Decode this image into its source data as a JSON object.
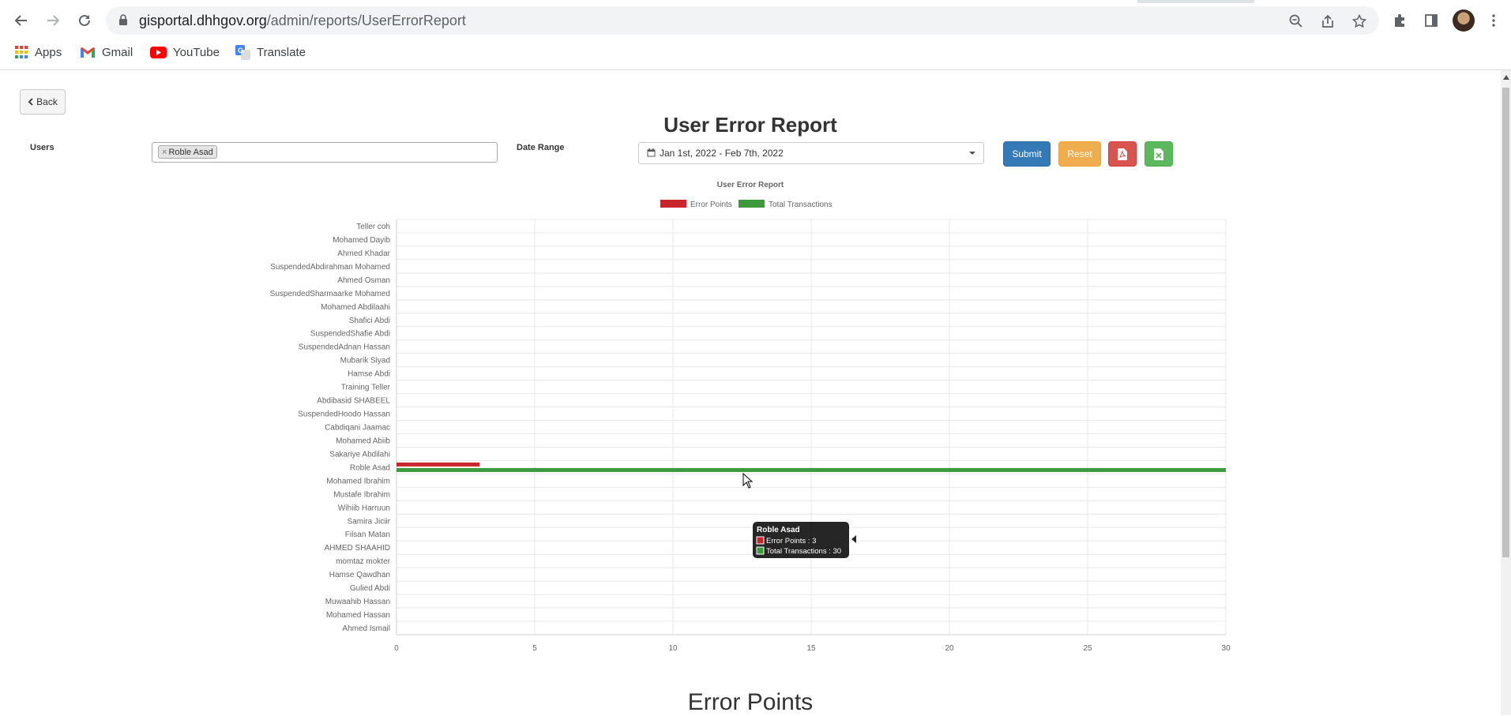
{
  "browser": {
    "url_domain": "gisportal.dhhgov.org",
    "url_path": "/admin/reports/UserErrorReport",
    "bookmarks": [
      {
        "label": "Apps",
        "icon": "apps-grid-icon"
      },
      {
        "label": "Gmail",
        "icon": "gmail-icon"
      },
      {
        "label": "YouTube",
        "icon": "youtube-icon"
      },
      {
        "label": "Translate",
        "icon": "translate-icon"
      }
    ]
  },
  "page": {
    "back_label": "Back",
    "title": "User Error Report",
    "users_label": "Users",
    "selected_user": "Roble Asad",
    "chip_remove": "×",
    "date_range_label": "Date Range",
    "date_range_value": "Jan 1st, 2022 - Feb 7th, 2022",
    "submit_label": "Submit",
    "reset_label": "Reset",
    "bottom_heading": "Error Points"
  },
  "colors": {
    "error": "#c9252c",
    "total": "#3c9a3c",
    "submit": "#337ab7",
    "reset": "#f0ad4e",
    "pdf": "#d9534f",
    "excel": "#5cb85c"
  },
  "tooltip": {
    "title": "Roble Asad",
    "line1": "Error Points : 3",
    "line2": "Total Transactions : 30"
  },
  "chart_data": {
    "type": "bar",
    "orientation": "horizontal",
    "title": "User Error Report",
    "legend_position": "top",
    "grid": true,
    "xlim": [
      0,
      30
    ],
    "x_ticks": [
      0,
      5,
      10,
      15,
      20,
      25,
      30
    ],
    "categories": [
      "Teller coh",
      "Mohamed Dayib",
      "Ahmed Khadar",
      "SuspendedAbdirahman Mohamed",
      "Ahmed Osman",
      "SuspendedSharmaarke Mohamed",
      "Mohamed Abdilaahi",
      "Shafici Abdi",
      "SuspendedShafie Abdi",
      "SuspendedAdnan Hassan",
      "Mubarik Siyad",
      "Hamse Abdi",
      "Training Teller",
      "Abdibasid SHABEEL",
      "SuspendedHoodo Hassan",
      "Cabdiqani Jaamac",
      "Mohamed Abiib",
      "Sakariye Abdilahi",
      "Roble Asad",
      "Mohamed Ibrahim",
      "Mustafe Ibrahim",
      "Wihiib Harruun",
      "Samira Jiciir",
      "Filsan Matan",
      "AHMED SHAAHID",
      "momtaz mokter",
      "Hamse Qawdhan",
      "Gulied Abdi",
      "Muwaahib Hassan",
      "Mohamed Hassan",
      "Ahmed Ismail"
    ],
    "series": [
      {
        "name": "Error Points",
        "color": "#c9252c",
        "values": [
          0,
          0,
          0,
          0,
          0,
          0,
          0,
          0,
          0,
          0,
          0,
          0,
          0,
          0,
          0,
          0,
          0,
          0,
          3,
          0,
          0,
          0,
          0,
          0,
          0,
          0,
          0,
          0,
          0,
          0,
          0
        ]
      },
      {
        "name": "Total Transactions",
        "color": "#3c9a3c",
        "values": [
          0,
          0,
          0,
          0,
          0,
          0,
          0,
          0,
          0,
          0,
          0,
          0,
          0,
          0,
          0,
          0,
          0,
          0,
          30,
          0,
          0,
          0,
          0,
          0,
          0,
          0,
          0,
          0,
          0,
          0,
          0
        ]
      }
    ]
  }
}
